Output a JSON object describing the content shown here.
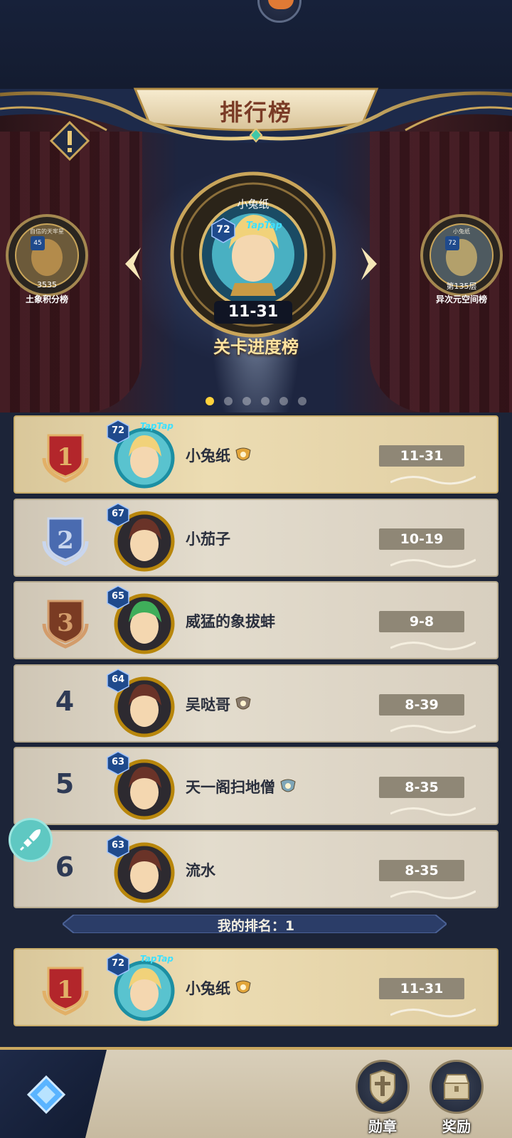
{
  "header": {
    "title": "排行榜"
  },
  "carousel": {
    "center": {
      "player_name": "小兔纸",
      "level": "72",
      "platform_badge": "TapTap",
      "score": "11-31",
      "board_name": "关卡进度榜"
    },
    "left": {
      "small_title": "自信的天牢星",
      "level": "45",
      "score": "3535",
      "board_name": "土象积分榜"
    },
    "right": {
      "small_title": "小兔纸",
      "level": "72",
      "score": "第135层",
      "board_name": "异次元空间榜"
    },
    "page_count": 6,
    "active_page": 1
  },
  "ranking": [
    {
      "rank": "1",
      "level": "72",
      "name": "小兔纸",
      "stage": "11-31",
      "taptap": "TapTap",
      "avatar_hair": "#f1d27a",
      "has_title": true,
      "title_color": "#e2a53a"
    },
    {
      "rank": "2",
      "level": "67",
      "name": "小茄子",
      "stage": "10-19",
      "taptap": "",
      "avatar_hair": "#6a3328",
      "has_title": false,
      "title_color": ""
    },
    {
      "rank": "3",
      "level": "65",
      "name": "威猛的象拔蚌",
      "stage": "9-8",
      "taptap": "",
      "avatar_hair": "#3fae5a",
      "has_title": false,
      "title_color": ""
    },
    {
      "rank": "4",
      "level": "64",
      "name": "吴哒哥",
      "stage": "8-39",
      "taptap": "",
      "avatar_hair": "#6a3328",
      "has_title": true,
      "title_color": "#8a7c6e"
    },
    {
      "rank": "5",
      "level": "63",
      "name": "天一阁扫地僧",
      "stage": "8-35",
      "taptap": "",
      "avatar_hair": "#6a3328",
      "has_title": true,
      "title_color": "#7fa6b8"
    },
    {
      "rank": "6",
      "level": "63",
      "name": "流水",
      "stage": "8-35",
      "taptap": "",
      "avatar_hair": "#6a3328",
      "has_title": false,
      "title_color": ""
    }
  ],
  "my_rank": {
    "label": "我的排名：1",
    "entry": {
      "rank": "1",
      "level": "72",
      "name": "小兔纸",
      "stage": "11-31",
      "taptap": "TapTap"
    }
  },
  "bottom": {
    "medal_label": "勋章",
    "reward_label": "奖励"
  },
  "colors": {
    "gold": "#d9c79a",
    "stage_box": "#8f8776",
    "page_dot_active": "#ffd23c",
    "level_hex": "#1f4a8c"
  },
  "icons": [
    "info-icon",
    "left-arrow-icon",
    "right-arrow-icon",
    "rocket-icon",
    "medal-icon",
    "reward-chest-icon"
  ]
}
